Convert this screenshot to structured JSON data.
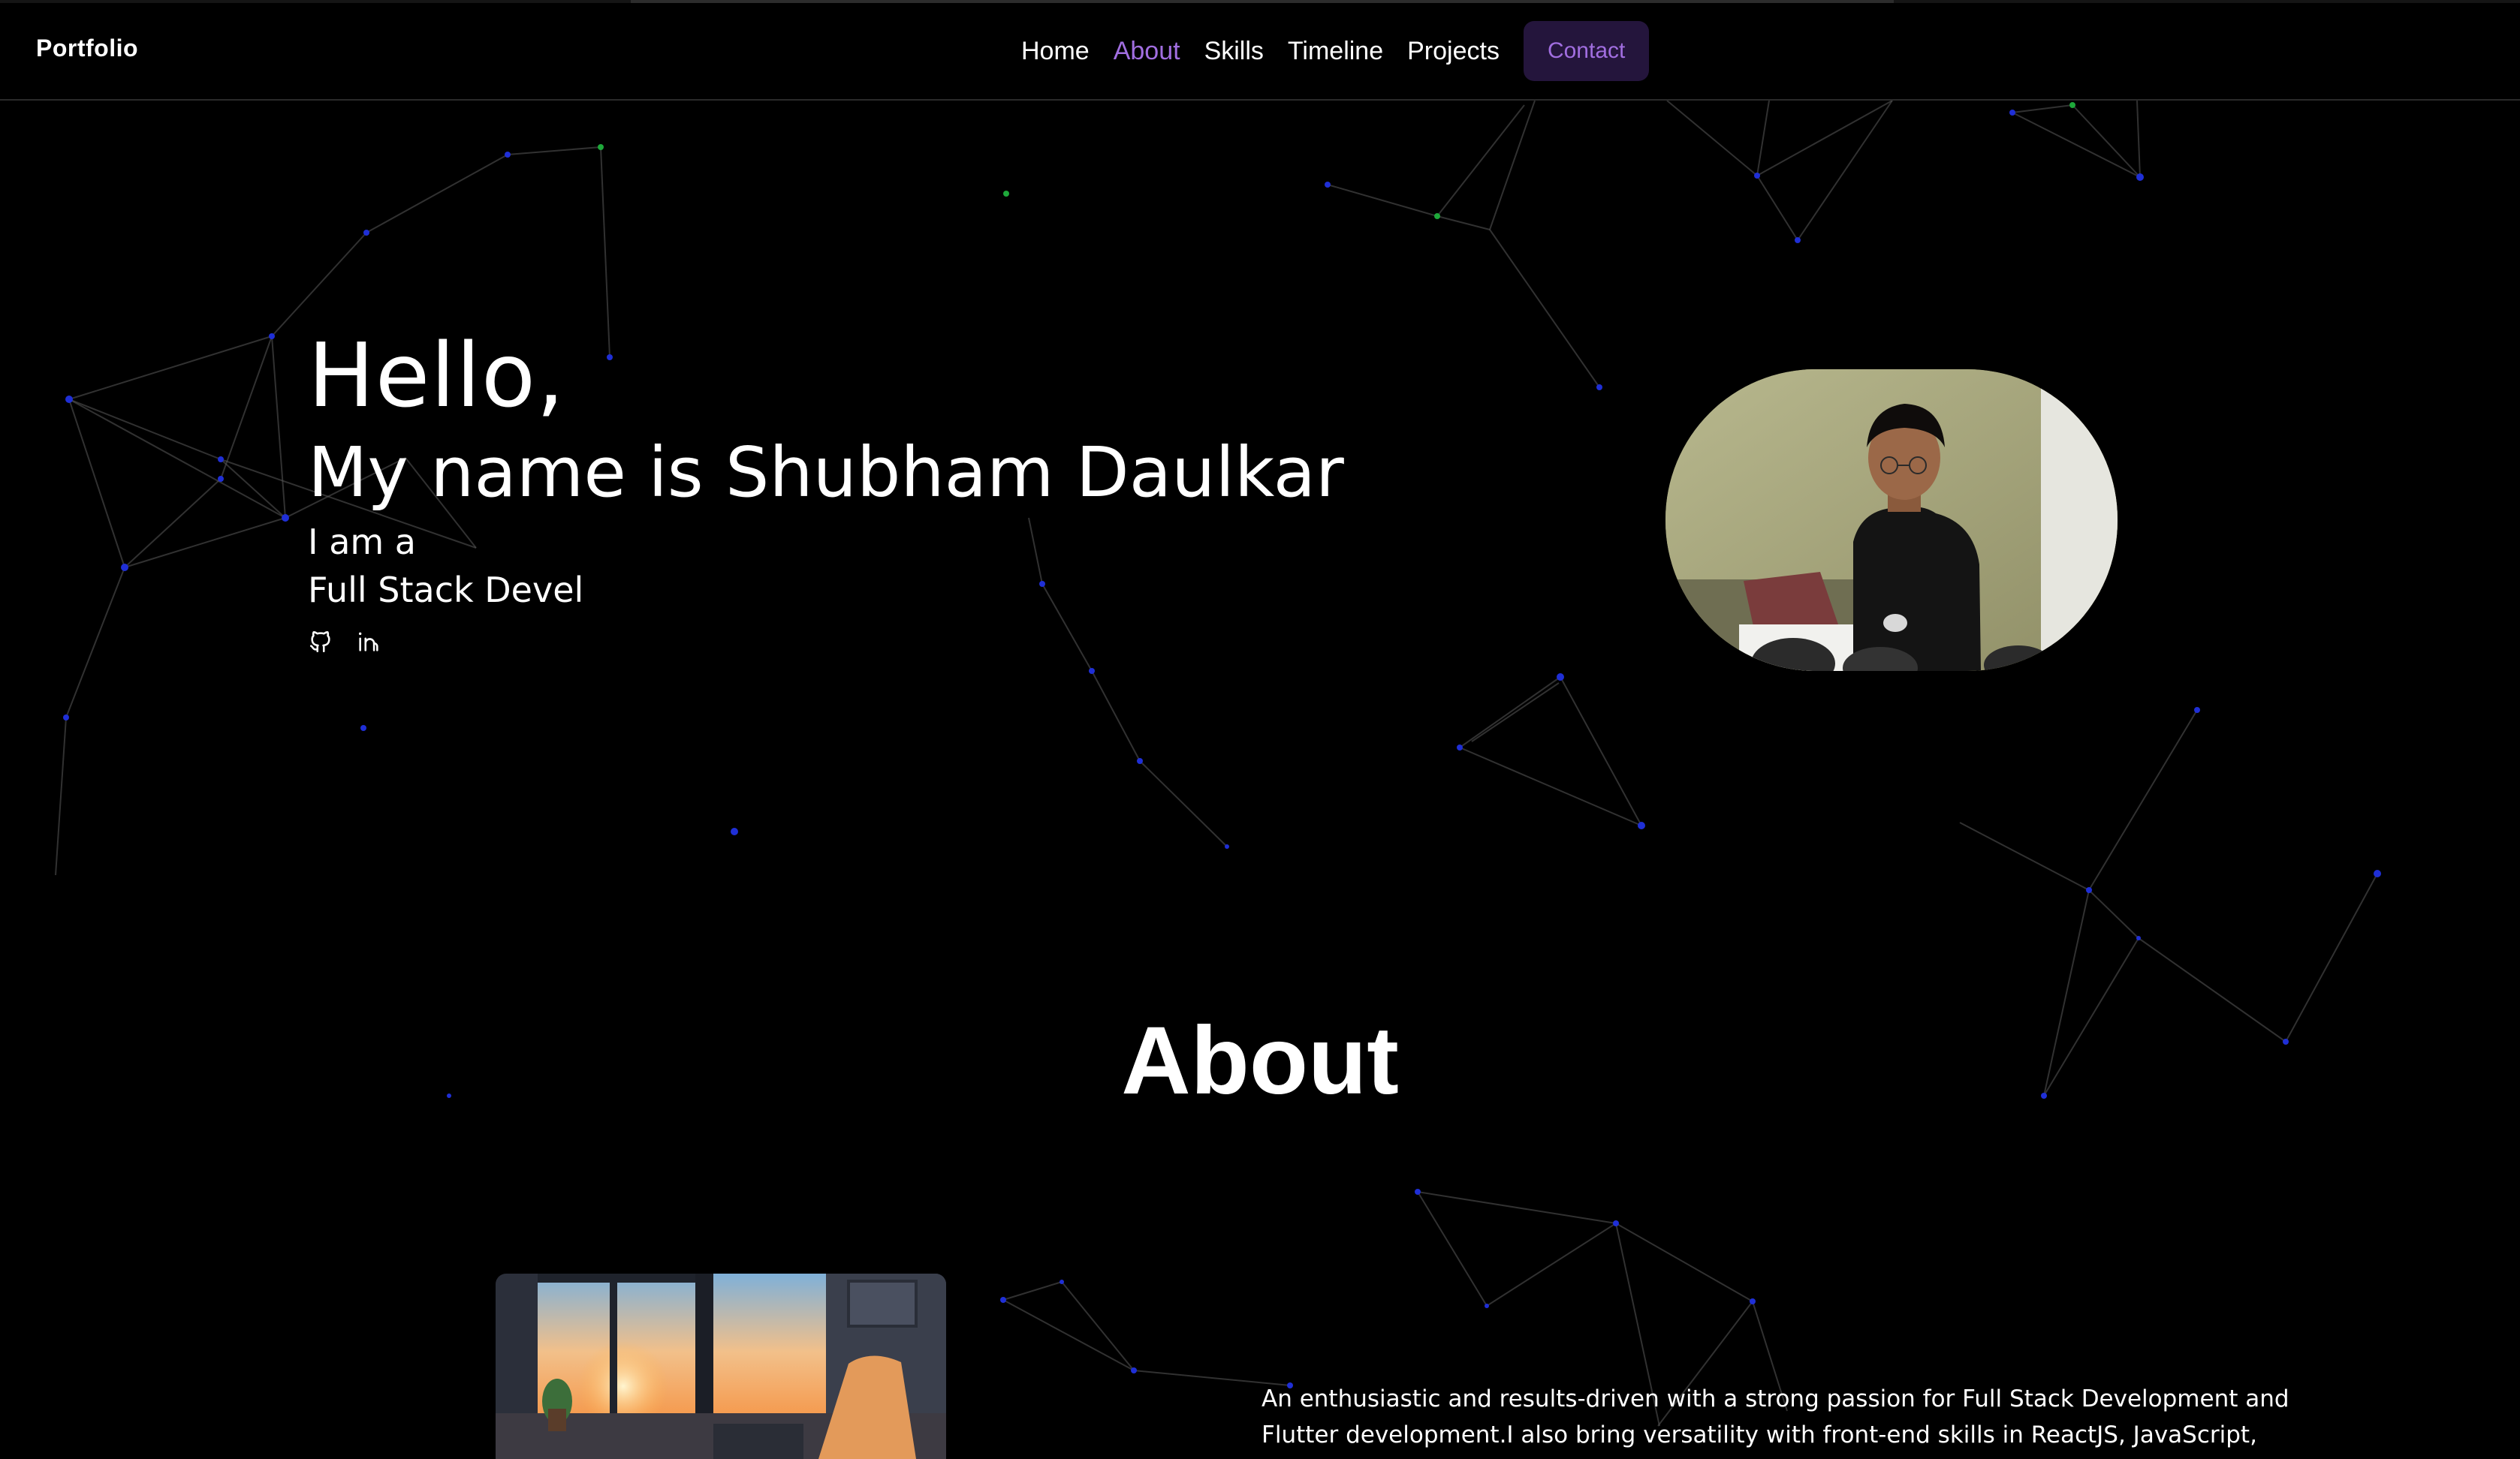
{
  "navbar": {
    "brand": "Portfolio",
    "links": [
      {
        "label": "Home",
        "active": false
      },
      {
        "label": "About",
        "active": true
      },
      {
        "label": "Skills",
        "active": false
      },
      {
        "label": "Timeline",
        "active": false
      },
      {
        "label": "Projects",
        "active": false
      }
    ],
    "contact_label": "Contact"
  },
  "hero": {
    "greeting": "Hello,",
    "name_line": "My name is Shubham Daulkar",
    "intro": "I am a",
    "typed_role": "Full Stack Devel",
    "socials": [
      {
        "icon": "github-icon"
      },
      {
        "icon": "linkedin-icon"
      }
    ]
  },
  "about": {
    "title": "About",
    "text": "An enthusiastic and results-driven with a strong passion for Full Stack Development and Flutter development.I also bring versatility with front-end skills in ReactJS, JavaScript, TypeScript, and"
  },
  "colors": {
    "background": "#000000",
    "accent": "#a16ee0",
    "contact_bg": "#24153c",
    "node_blue": "#1f2fd6",
    "node_green": "#1ea83a"
  }
}
